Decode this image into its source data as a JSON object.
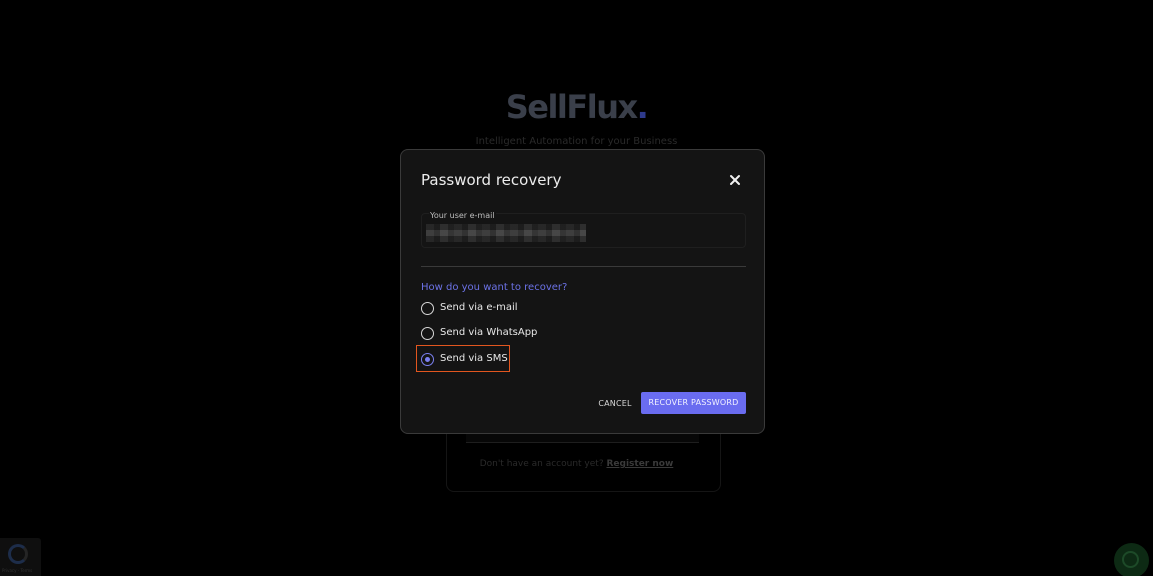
{
  "background": {
    "logo_text": "SellFlux",
    "logo_dot": ".",
    "tagline": "Intelligent Automation for your Business",
    "register_prompt": "Don't have an account yet?",
    "register_link": "Register now",
    "recaptcha_terms": "Privacy - Terms"
  },
  "modal": {
    "title": "Password recovery",
    "email_label": "Your user e-mail",
    "question": "How do you want to recover?",
    "options": [
      {
        "label": "Send via e-mail",
        "selected": false
      },
      {
        "label": "Send via WhatsApp",
        "selected": false
      },
      {
        "label": "Send via SMS",
        "selected": true
      }
    ],
    "cancel_label": "CANCEL",
    "submit_label": "RECOVER PASSWORD"
  },
  "icons": {
    "close": "close-icon",
    "whatsapp": "whatsapp-icon",
    "recaptcha": "recaptcha-icon"
  },
  "colors": {
    "accent": "#6a6cf0",
    "highlight": "#e2561f",
    "modal_bg": "#141414"
  }
}
